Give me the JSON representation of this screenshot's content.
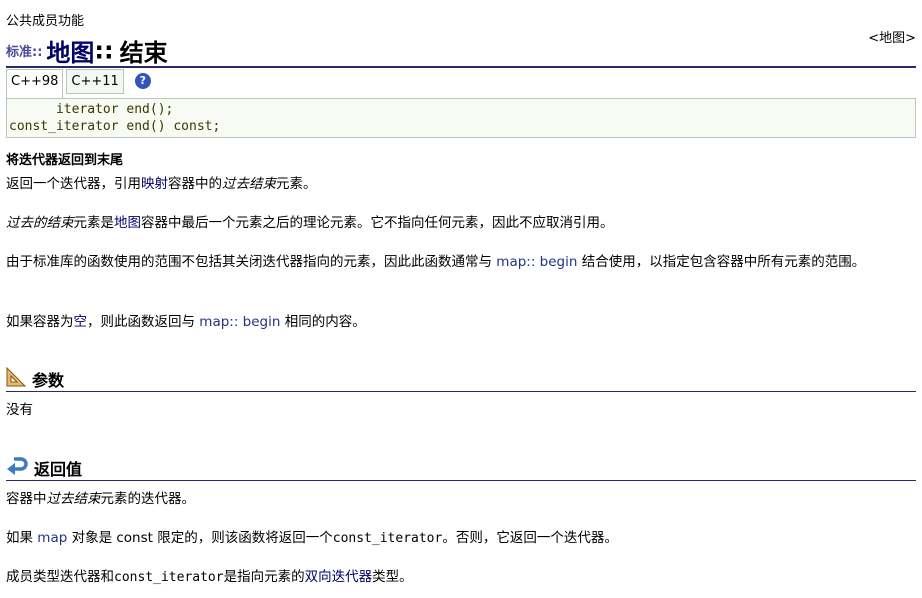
{
  "breadcrumb": "公共成员功能",
  "back_link": "<地图>",
  "title": {
    "namespace": "标准::",
    "class": "地图",
    "separator": "::",
    "function": "结束"
  },
  "tabs": [
    "C++98",
    "C++11"
  ],
  "help_icon_glyph": "?",
  "code": [
    "      iterator end();",
    "const_iterator end() const;"
  ],
  "description_heading": "将迭代器返回到末尾",
  "p1": {
    "a": "返回一个迭代器，引用",
    "link": "映射",
    "b": "容器中的",
    "em": "过去结束",
    "c": "元素。"
  },
  "p2": {
    "em": "过去的结束",
    "a": "元素是",
    "link": "地图",
    "b": "容器中最后一个元素之后的理论元素。它不指向任何元素，因此不应取消引用。"
  },
  "p3": {
    "a": "由于标准库的函数使用的范围不包括其关闭迭代器指向的元素，因此此函数通常与 ",
    "link": "map:: begin",
    "b": " 结合使用，以指定包含容器中所有元素的范围。"
  },
  "p4": {
    "a": "如果容器为",
    "link1": "空",
    "b": "，则此函数返回与 ",
    "link2": "map:: begin",
    "c": " 相同的内容。"
  },
  "params": {
    "heading": "参数",
    "text": "没有"
  },
  "returns": {
    "heading": "返回值",
    "r1": {
      "a": "容器中",
      "em": "过去结束",
      "b": "元素的迭代器。"
    },
    "r2": {
      "a": "如果 ",
      "link": "map",
      "b": " 对象是 const 限定的，则该函数将返回一个",
      "code1": "const_iterator",
      "c": "。否则，它返回一个迭代器。"
    },
    "r3": {
      "a": "成员类型迭代器和",
      "code1": "const_iterator",
      "b": "是指向元素的",
      "link": "双向迭代器",
      "c": "类型。"
    }
  }
}
